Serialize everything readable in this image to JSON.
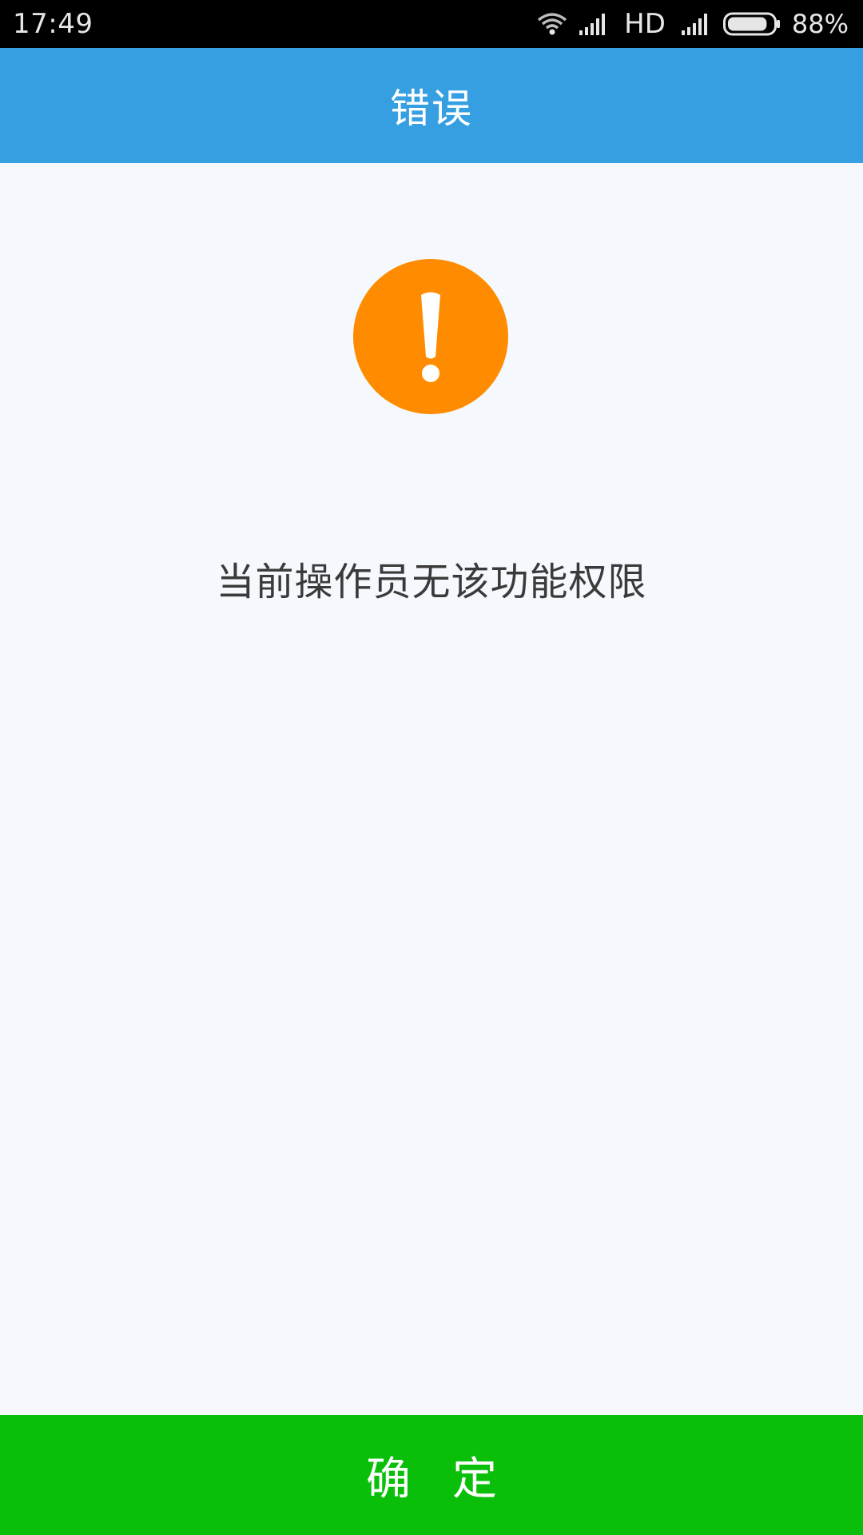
{
  "status_bar": {
    "time": "17:49",
    "network": "HD",
    "battery": "88%",
    "battery_level": 0.88,
    "icons": [
      "wifi-icon",
      "signal-icon",
      "signal-icon",
      "battery-icon"
    ]
  },
  "header": {
    "title": "错误",
    "color": "#369fe1"
  },
  "alert": {
    "icon": "exclamation-icon",
    "icon_color": "#ff8c00",
    "message": "当前操作员无该功能权限"
  },
  "footer": {
    "confirm_label": "确定",
    "button_color": "#0abf0a"
  }
}
